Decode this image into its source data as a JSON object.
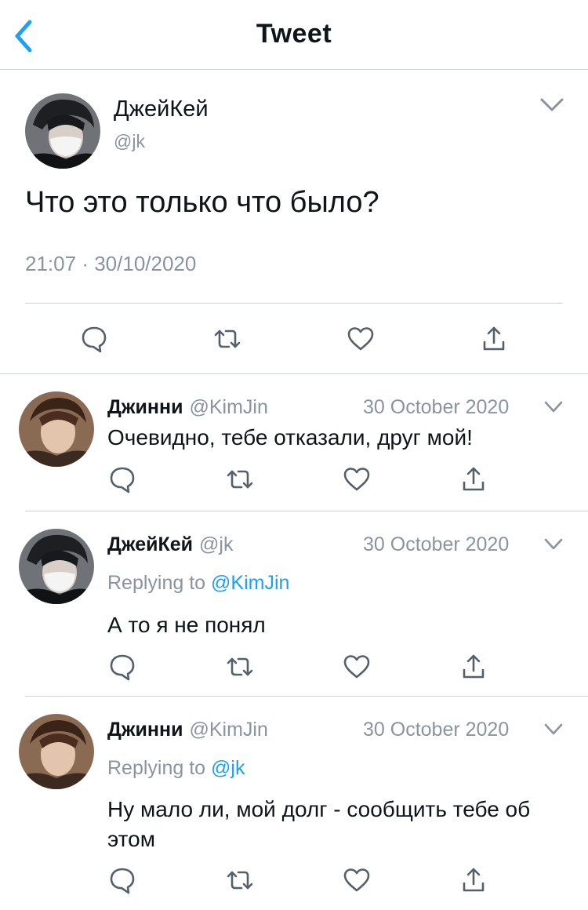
{
  "header": {
    "title": "Tweet"
  },
  "colors": {
    "link": "#1da1f2",
    "muted": "#8a949e",
    "divider": "#cfd4d8",
    "text": "#0f1419"
  },
  "main_tweet": {
    "name": "ДжейКей",
    "handle": "@jk",
    "text": "Что это только что было?",
    "time": "21:07",
    "separator": "·",
    "date": "30/10/2020",
    "actions": [
      "reply-icon",
      "retweet-icon",
      "like-icon",
      "share-icon"
    ]
  },
  "replies": [
    {
      "name": "Джинни",
      "handle": "@KimJin",
      "date": "30 October 2020",
      "replying_prefix": "",
      "replying_to": "",
      "text": "Очевидно, тебе отказали, друг мой!"
    },
    {
      "name": "ДжейКей",
      "handle": "@jk",
      "date": "30 October 2020",
      "replying_prefix": "Replying to",
      "replying_to": "@KimJin",
      "text": "А то я не понял"
    },
    {
      "name": "Джинни",
      "handle": "@KimJin",
      "date": "30 October 2020",
      "replying_prefix": "Replying to",
      "replying_to": "@jk",
      "text": "Ну мало ли, мой долг - сообщить тебе об этом"
    }
  ]
}
